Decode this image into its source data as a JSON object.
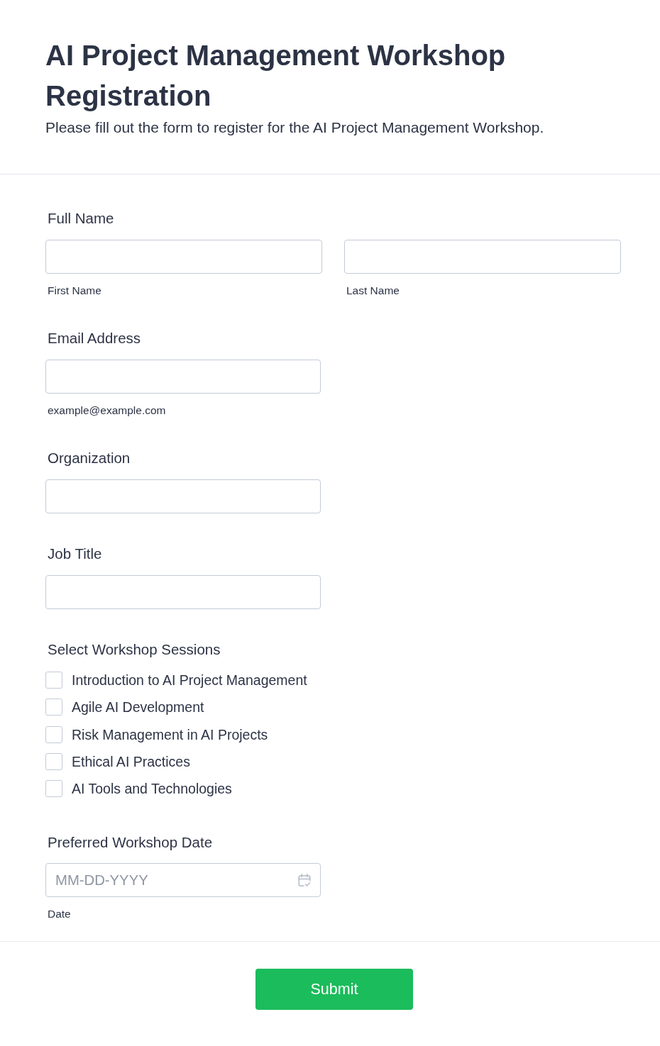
{
  "header": {
    "title": "AI Project Management Workshop Registration",
    "description": "Please fill out the form to register for the AI Project Management Workshop."
  },
  "fields": [
    {
      "kind": "name",
      "label": "Full Name",
      "parts": [
        {
          "sublabel": "First Name"
        },
        {
          "sublabel": "Last Name"
        }
      ]
    },
    {
      "kind": "text",
      "label": "Email Address",
      "sublabel": "example@example.com"
    },
    {
      "kind": "text",
      "label": "Organization"
    },
    {
      "kind": "text",
      "label": "Job Title"
    },
    {
      "kind": "checkboxes",
      "label": "Select Workshop Sessions",
      "options": [
        {
          "label": "Introduction to AI Project Management",
          "checked": false
        },
        {
          "label": "Agile AI Development",
          "checked": false
        },
        {
          "label": "Risk Management in AI Projects",
          "checked": false
        },
        {
          "label": "Ethical AI Practices",
          "checked": false
        },
        {
          "label": "AI Tools and Technologies",
          "checked": false
        }
      ]
    },
    {
      "kind": "date",
      "label": "Preferred Workshop Date",
      "placeholder": "MM-DD-YYYY",
      "sublabel": "Date"
    }
  ],
  "submit": {
    "label": "Submit"
  }
}
